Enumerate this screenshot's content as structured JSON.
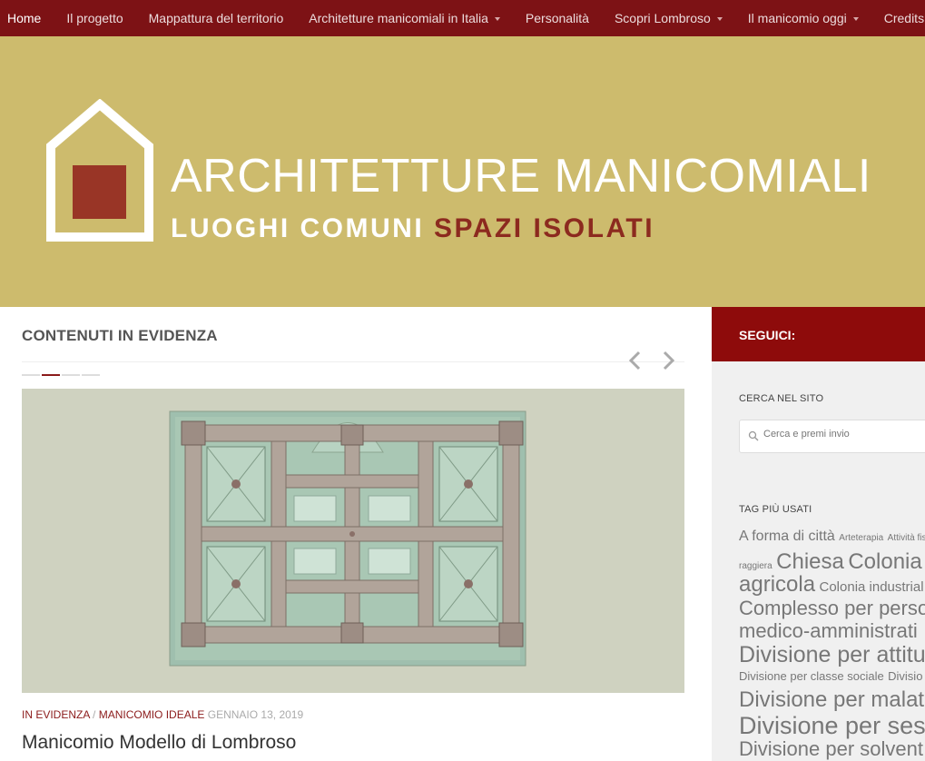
{
  "nav": {
    "items": [
      {
        "label": "Home"
      },
      {
        "label": "Il progetto"
      },
      {
        "label": "Mappattura del territorio"
      },
      {
        "label": "Architetture manicomiali in Italia"
      },
      {
        "label": "Personalità"
      },
      {
        "label": "Scopri Lombroso"
      },
      {
        "label": "Il manicomio oggi"
      },
      {
        "label": "Credits"
      }
    ]
  },
  "header": {
    "title": "ARCHITETTURE MANICOMIALI",
    "subtitle_part1": "LUOGHI COMUNI",
    "subtitle_part2": "SPAZI ISOLATI"
  },
  "featured": {
    "section_title": "CONTENUTI IN EVIDENZA",
    "category1": "IN EVIDENZA",
    "separator": "/",
    "category2": "MANICOMIO IDEALE",
    "date": "GENNAIO 13, 2019",
    "post_title": "Manicomio Modello di Lombroso"
  },
  "sidebar": {
    "heading": "SEGUICI:",
    "search_title": "CERCA NEL SITO",
    "search_placeholder": "Cerca e premi invio",
    "tags_title": "TAG PIÙ USATI",
    "tags": {
      "t1": "A forma di città",
      "t2": "Arteterapia",
      "t3": "Attività fis",
      "t4": "raggiera",
      "t5": "Chiesa",
      "t6": "Colonia",
      "t7": "agricola",
      "t8": "Colonia industrial",
      "t9": "Complesso per perso",
      "t10": "medico-amministrati",
      "t11": "Divisione per attitu",
      "t12": "Divisione per classe sociale",
      "t13": "Divisio",
      "t14": "Divisione per malat",
      "t15": "Divisione per ses",
      "t16": "Divisione per solvent"
    }
  },
  "colors": {
    "nav_bg": "#7d1215",
    "header_bg": "#cdbb6d",
    "accent_red": "#8b1a1a",
    "sidebar_head": "#8e0b0b"
  }
}
